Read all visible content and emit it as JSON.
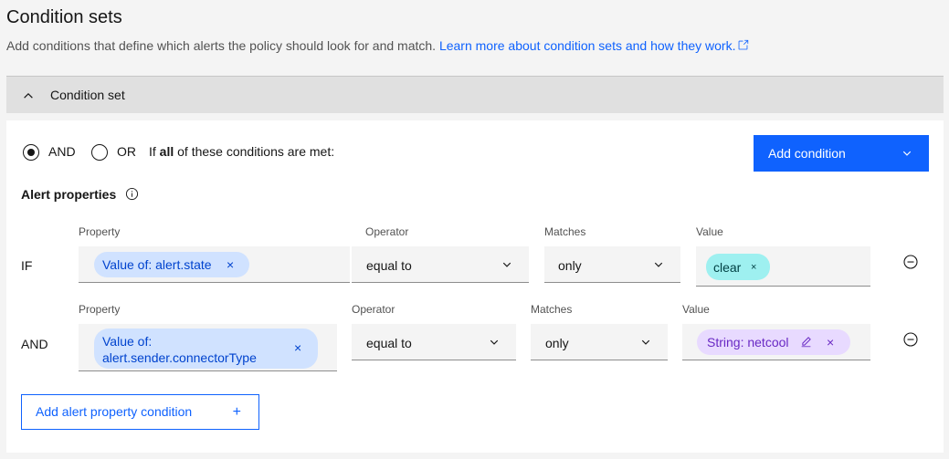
{
  "header": {
    "title": "Condition sets",
    "description": "Add conditions that define which alerts the policy should look for and match. ",
    "learn_more_link": "Learn more about condition sets and how they work."
  },
  "accordion": {
    "title": "Condition set",
    "expanded": true
  },
  "logic": {
    "options": [
      {
        "label": "AND",
        "selected": true
      },
      {
        "label": "OR",
        "selected": false
      }
    ],
    "statement_prefix": "If ",
    "statement_bold": "all",
    "statement_suffix": " of these conditions are met:"
  },
  "add_condition_button": "Add condition",
  "alert_properties": {
    "title": "Alert properties",
    "rows": [
      {
        "row_label": "IF",
        "property_label": "Property",
        "property_tag": "Value of: alert.state",
        "operator_label": "Operator",
        "operator_value": "equal to",
        "matches_label": "Matches",
        "matches_value": "only",
        "value_label": "Value",
        "value_tag": "clear"
      },
      {
        "row_label": "AND",
        "property_label": "Property",
        "property_tag_line1": "Value of:",
        "property_tag_line2": "alert.sender.connectorType",
        "operator_label": "Operator",
        "operator_value": "equal to",
        "matches_label": "Matches",
        "matches_value": "only",
        "value_label": "Value",
        "value_tag": "String: netcool"
      }
    ]
  },
  "add_property_button": "Add alert property condition",
  "icons": {
    "close": "×",
    "plus": "+"
  },
  "colors": {
    "primary": "#0f62fe",
    "tag_blue": "#d0e2ff",
    "tag_teal": "#9ef0f0",
    "tag_purple": "#e8daff"
  }
}
